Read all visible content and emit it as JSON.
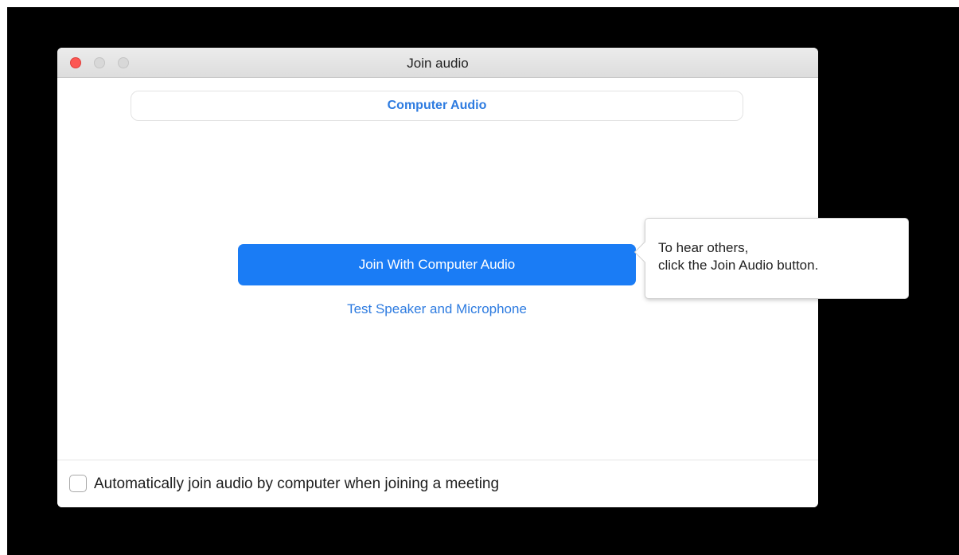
{
  "window": {
    "title": "Join audio"
  },
  "tabs": [
    {
      "label": "Computer Audio",
      "selected": true
    }
  ],
  "main": {
    "join_button_label": "Join With Computer Audio",
    "test_link_label": "Test Speaker and Microphone"
  },
  "tooltip": {
    "line1": "To hear others,",
    "line2": "click the Join Audio button."
  },
  "footer": {
    "checkbox_label": "Automatically join audio by computer when joining a meeting",
    "checkbox_checked": false
  },
  "colors": {
    "accent": "#1a7cf5",
    "link": "#2d7be0",
    "close_button": "#fc5753",
    "background": "#000000"
  }
}
